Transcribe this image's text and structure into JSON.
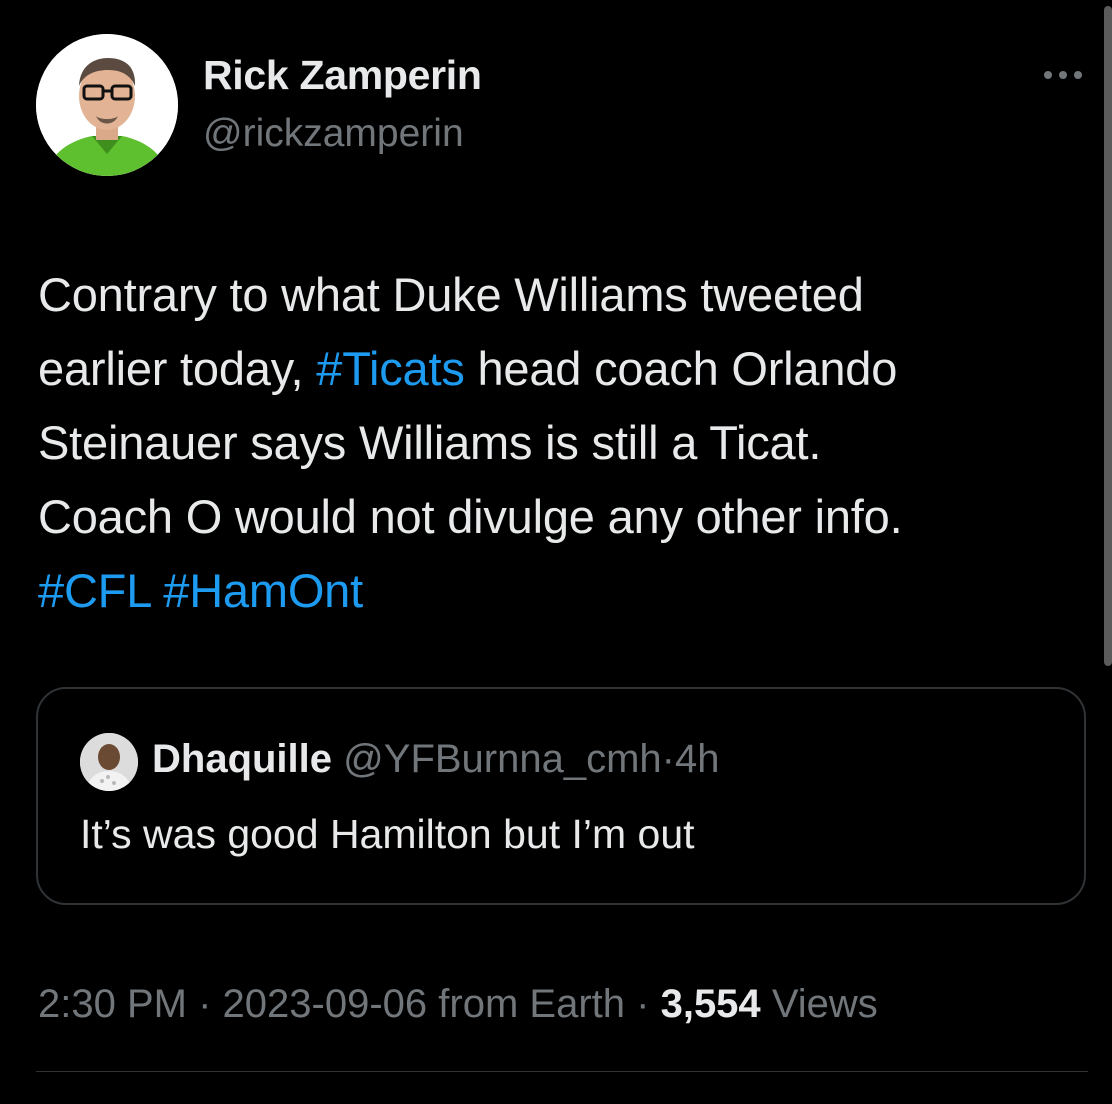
{
  "author": {
    "display_name": "Rick Zamperin",
    "handle": "@rickzamperin"
  },
  "more_icon": "more-horizontal-icon",
  "tweet": {
    "line1": "Contrary to what Duke Williams tweeted",
    "line2_pre": "earlier today, ",
    "hashtag_ticats": "#Ticats",
    "line2_post": " head coach Orlando",
    "line3": "Steinauer says Williams is still a Ticat.",
    "line4": "Coach O would not divulge any other info.",
    "hashtag_cfl": "#CFL",
    "hashtag_hamont": "#HamOnt"
  },
  "quote": {
    "display_name": "Dhaquille",
    "handle": "@YFBurnna_cmh",
    "separator": "·",
    "time": "4h",
    "text": "It’s was good Hamilton but I’m out"
  },
  "meta": {
    "time": "2:30 PM",
    "sep1": "·",
    "date": "2023-09-06",
    "source": "from Earth",
    "sep2": "·",
    "views_count": "3,554",
    "views_label": "Views"
  },
  "colors": {
    "background": "#000000",
    "text": "#e7e9ea",
    "secondary": "#71767b",
    "link": "#1d9bf0",
    "border": "#2f3336"
  }
}
